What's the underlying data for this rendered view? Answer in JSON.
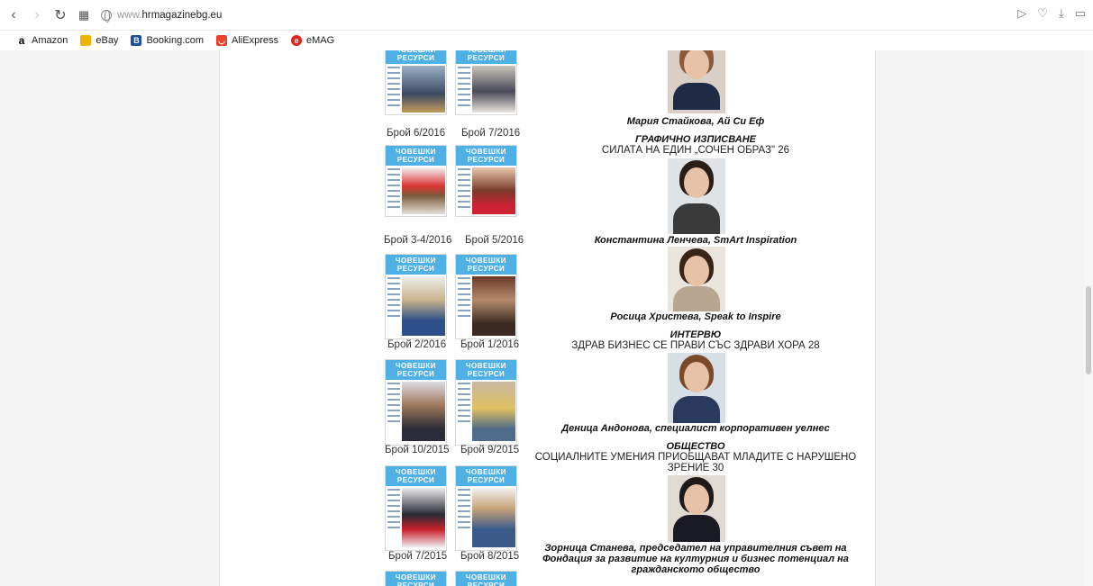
{
  "browser": {
    "url_prefix": "www.",
    "url_host": "hrmagazinebg.eu"
  },
  "bookmarks": [
    {
      "label": "Amazon",
      "icon": "amazon-icon",
      "color": "#000000"
    },
    {
      "label": "eBay",
      "icon": "ebay-icon",
      "color": "#e53238"
    },
    {
      "label": "Booking.com",
      "icon": "booking-icon",
      "color": "#1f4f9c"
    },
    {
      "label": "AliExpress",
      "icon": "aliexpress-icon",
      "color": "#e8412b"
    },
    {
      "label": "eMAG",
      "icon": "emag-icon",
      "color": "#e0241b"
    }
  ],
  "covers": {
    "mast_text": "ЧОВЕШКИ РЕСУРСИ",
    "captions": [
      "Брой 6/2016",
      "Брой 7/2016",
      "Брой 3-4/2016",
      "Брой 5/2016",
      "Брой 2/2016",
      "Брой 1/2016",
      "Брой 10/2015",
      "Брой 9/2015",
      "Брой 7/2015",
      "Брой 8/2015"
    ]
  },
  "articles": {
    "p1_caption": "Мария Стайкова, Ай Си Еф",
    "s1_title": "ГРАФИЧНО ИЗПИСВАНЕ",
    "s1_line": "СИЛАТА НА ЕДИН „СОЧЕН ОБРАЗ\"   26",
    "p2_caption": "Константина Ленчева, SmArt Inspiration",
    "p3_caption": "Росица Христева, Speak to Inspire",
    "s2_title": "ИНТЕРВЮ",
    "s2_line": "ЗДРАВ БИЗНЕС СЕ ПРАВИ СЪС ЗДРАВИ ХОРА   28",
    "p4_caption": "Деница Андонова, специалист корпоративен уелнес",
    "s3_title": "ОБЩЕСТВО",
    "s3_line1": "СОЦИАЛНИТЕ УМЕНИЯ ПРИОБЩАВАТ МЛАДИТЕ С НАРУШЕНО",
    "s3_line2": "ЗРЕНИЕ   30",
    "p5_caption_1": "Зорница Станева, председател на управителния съвет на",
    "p5_caption_2": "Фондация за развитие на културния и бизнес потенциал на",
    "p5_caption_3": "гражданското общество"
  }
}
